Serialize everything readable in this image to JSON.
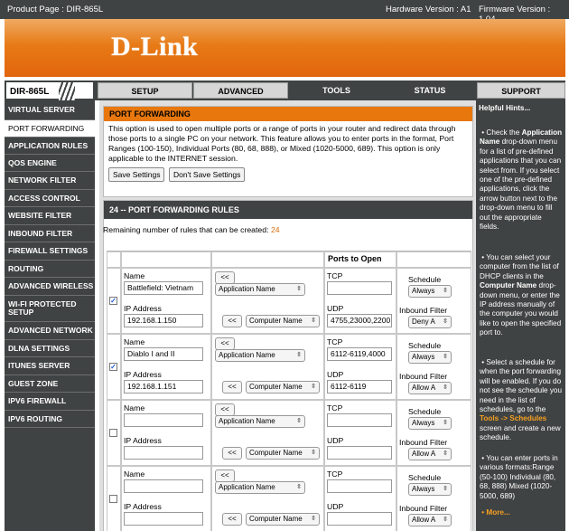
{
  "topbar": {
    "product": "Product Page : DIR-865L",
    "hardware": "Hardware Version : A1",
    "firmware": "Firmware Version : 1.04"
  },
  "brand": {
    "logo": "D-Link"
  },
  "nav": {
    "model": "DIR-865L",
    "tabs": [
      "SETUP",
      "ADVANCED",
      "TOOLS",
      "STATUS",
      "SUPPORT"
    ]
  },
  "sidebar": {
    "items": [
      "VIRTUAL SERVER",
      "PORT FORWARDING",
      "APPLICATION RULES",
      "QOS ENGINE",
      "NETWORK FILTER",
      "ACCESS CONTROL",
      "WEBSITE FILTER",
      "INBOUND FILTER",
      "FIREWALL SETTINGS",
      "ROUTING",
      "ADVANCED WIRELESS",
      "WI-FI PROTECTED SETUP",
      "ADVANCED NETWORK",
      "DLNA SETTINGS",
      "ITUNES SERVER",
      "GUEST ZONE",
      "IPV6 FIREWALL",
      "IPV6 ROUTING"
    ],
    "active": 1
  },
  "port_forwarding": {
    "title": "PORT FORWARDING",
    "description": "This option is used to open multiple ports or a range of ports in your router and redirect data through those ports to a single PC on your network. This feature allows you to enter ports in the format, Port Ranges (100-150), Individual Ports (80, 68, 888), or Mixed (1020-5000, 689). This option is only applicable to the INTERNET session.",
    "save_label": "Save Settings",
    "dont_save_label": "Don't Save Settings"
  },
  "rules": {
    "title": "24 -- PORT FORWARDING RULES",
    "remaining_label": "Remaining number of rules that can be created:",
    "remaining_value": "24",
    "ports_header": "Ports to Open",
    "labels": {
      "name": "Name",
      "ip": "IP Address",
      "tcp": "TCP",
      "udp": "UDP",
      "schedule": "Schedule",
      "inbound": "Inbound Filter",
      "arrow": "<<"
    },
    "rows": [
      {
        "checked": true,
        "name": "Battlefield: Vietnam",
        "app": "Application Name",
        "ip": "192.168.1.150",
        "computer": "Computer Name",
        "tcp": "",
        "udp": "4755,23000,2200",
        "schedule": "Always",
        "inbound": "Deny A"
      },
      {
        "checked": true,
        "name": "Diablo I and II",
        "app": "Application Name",
        "ip": "192.168.1.151",
        "computer": "Computer Name",
        "tcp": "6112-6119,4000",
        "udp": "6112-6119",
        "schedule": "Always",
        "inbound": "Allow A"
      },
      {
        "checked": false,
        "name": "",
        "app": "Application Name",
        "ip": "",
        "computer": "Computer Name",
        "tcp": "",
        "udp": "",
        "schedule": "Always",
        "inbound": "Allow A"
      },
      {
        "checked": false,
        "name": "",
        "app": "Application Name",
        "ip": "",
        "computer": "Computer Name",
        "tcp": "",
        "udp": "",
        "schedule": "Always",
        "inbound": "Allow A"
      }
    ]
  },
  "hints": {
    "title": "Helpful Hints...",
    "h1_a": "Check the ",
    "h1_b": "Application Name",
    "h1_c": " drop-down menu for a list of pre-defined applications that you can select from. If you select one of the pre-defined applications, click the arrow button next to the drop-down menu to fill out the appropriate fields.",
    "h2_a": "You can select your computer from the list of DHCP clients in the ",
    "h2_b": "Computer Name",
    "h2_c": " drop-down menu, or enter the IP address manually of the computer you would like to open the specified port to.",
    "h3_a": "Select a schedule for when the port forwarding will be enabled. If you do not see the schedule you need in the list of schedules, go to the ",
    "h3_b": "Tools -> Schedules",
    "h3_c": " screen and create a new schedule.",
    "h4": "You can enter ports in various formats:Range (50-100) Individual (80, 68, 888) Mixed (1020-5000, 689)",
    "more": "More..."
  }
}
